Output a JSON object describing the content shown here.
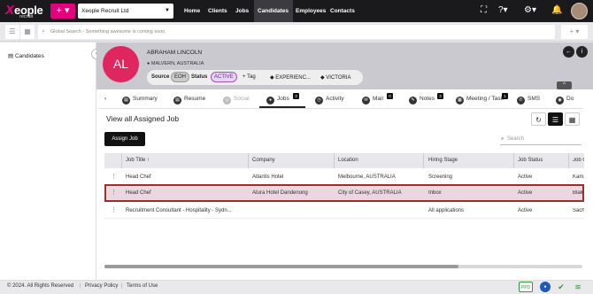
{
  "topbar": {
    "logo_text": "eople",
    "logo_sub": "recruit",
    "add_label": "+ ▾",
    "company": "Xeople Recruit Ltd",
    "nav": [
      "Home",
      "Clients",
      "Jobs",
      "Candidates",
      "Employees",
      "Contacts"
    ]
  },
  "search": {
    "placeholder": "Global Search - Something awesome is coming soon"
  },
  "sidebar": {
    "item": "Candidates"
  },
  "candidate": {
    "initials": "AL",
    "name": "ABRAHAM LINCOLN",
    "location": "MALVERN, AUSTRALIA",
    "source_label": "Source",
    "source_value": "EOH",
    "status_label": "Status",
    "status_value": "ACTIVE",
    "tag_label": "Tag",
    "experience": "EXPERIENC...",
    "victoria": "VICTORIA"
  },
  "tabs": [
    {
      "label": "Summary"
    },
    {
      "label": "Resume"
    },
    {
      "label": "Social"
    },
    {
      "label": "Jobs",
      "count": "3"
    },
    {
      "label": "Activity"
    },
    {
      "label": "Mail",
      "count": "0"
    },
    {
      "label": "Notes",
      "count": "3"
    },
    {
      "label": "Meeting / Task",
      "count": "1"
    },
    {
      "label": "SMS"
    },
    {
      "label": "Do"
    }
  ],
  "section": {
    "title": "View all Assigned Job",
    "assign_button": "Assign Job",
    "search_placeholder": "Search"
  },
  "table": {
    "columns": [
      "Job Title ↑",
      "Company",
      "Location",
      "Hiring Stage",
      "Job Status",
      "Job Owne"
    ],
    "rows": [
      [
        "Head Chef",
        "Atlantis Hotel",
        "Melbourne, AUSTRALIA",
        "Screening",
        "Active",
        "Kamaksh"
      ],
      [
        "Head Chef",
        "Atura Hotel Dandenong",
        "City of Casey, AUSTRALIA",
        "Inbox",
        "Active",
        "Blakestar"
      ],
      [
        "Recruitment Consultant - Hospitality - Sydn...",
        "",
        "",
        "All applications",
        "Active",
        "SachinEn"
      ]
    ]
  },
  "footer": {
    "copyright": "© 2024. All Rights Reserved",
    "privacy": "Privacy Policy",
    "terms": "Terms of Use",
    "ppd": "PPD"
  },
  "colors": {
    "brand": "#e3007f",
    "avatar": "#e0265e",
    "selected_border": "#9b2f2b"
  }
}
